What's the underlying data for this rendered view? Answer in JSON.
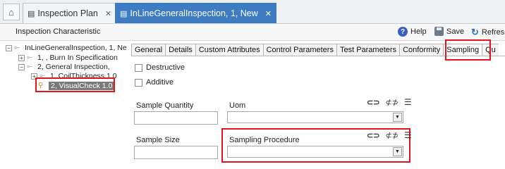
{
  "tabs": [
    {
      "label": "Inspection Plan",
      "close": "✕"
    },
    {
      "label": "InLineGeneralInspection, 1, New",
      "close": "✕"
    }
  ],
  "toolbar": {
    "title": "Inspection Characteristic",
    "help_label": "Help",
    "save_label": "Save",
    "refresh_label": "Refres"
  },
  "tree": {
    "root": "InLineGeneralInspection, 1, Ne",
    "items": [
      {
        "label": "1, , Burn In Specification"
      },
      {
        "label": "2, General Inspection,"
      },
      {
        "label": "1, CoilThickness 1.0"
      },
      {
        "label": "2, VisualCheck 1.0"
      }
    ]
  },
  "property_tabs": [
    {
      "label": "General"
    },
    {
      "label": "Details"
    },
    {
      "label": "Custom Attributes"
    },
    {
      "label": "Control Parameters"
    },
    {
      "label": "Test Parameters"
    },
    {
      "label": "Conformity"
    },
    {
      "label": "Sampling"
    },
    {
      "label": "Qu"
    }
  ],
  "form": {
    "destructive_label": "Destructive",
    "additive_label": "Additive",
    "sample_quantity_label": "Sample Quantity",
    "uom_label": "Uom",
    "sample_size_label": "Sample Size",
    "sampling_procedure_label": "Sampling Procedure"
  },
  "colors": {
    "active_tab": "#3d7cc2",
    "highlight": "#e4141c"
  }
}
